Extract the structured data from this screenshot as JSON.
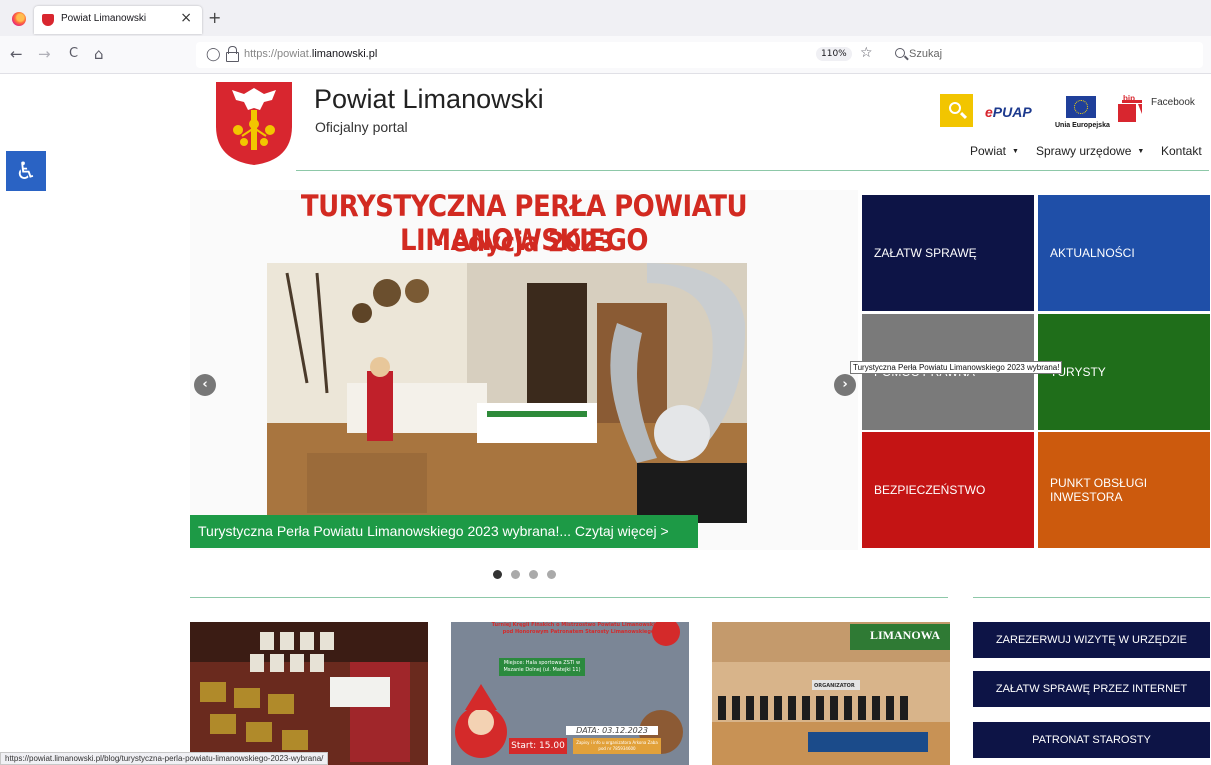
{
  "browser": {
    "tab_title": "Powiat Limanowski",
    "tab_close": "×",
    "new_tab": "+",
    "back": "←",
    "forward": "→",
    "reload": "C",
    "home": "⌂",
    "url_prefix": "https://powiat.",
    "url_domain": "limanowski.pl",
    "zoom": "110%",
    "search_placeholder": "Szukaj"
  },
  "header": {
    "title": "Powiat Limanowski",
    "subtitle": "Oficjalny portal",
    "epuap_prefix": "e",
    "epuap_rest": "PUAP",
    "eu_label": "Unia Europejska",
    "bip_label": "bip",
    "facebook": "Facebook"
  },
  "menu": {
    "items": [
      {
        "label": "Powiat",
        "caret": "▼"
      },
      {
        "label": "Sprawy urzędowe",
        "caret": "▼"
      },
      {
        "label": "Kontakt"
      }
    ]
  },
  "slider": {
    "headline_line1": "TURYSTYCZNA PERŁA POWIATU LIMANOWSKIEGO",
    "headline_line2": "- edycja 2023",
    "caption": "Turystyczna Perła Powiatu Limanowskiego 2023 wybrana!... Czytaj więcej >",
    "prev": "‹",
    "next": "›",
    "slide_count": 4,
    "active_slide": 1
  },
  "tooltip": "Turystyczna Perła Powiatu Limanowskiego 2023 wybrana!",
  "tiles": [
    {
      "label": "ZAŁATW SPRAWĘ",
      "color": "#0d1446"
    },
    {
      "label": "AKTUALNOŚCI",
      "color": "#1f4fa8"
    },
    {
      "label": "POMOC PRAWNA",
      "color": "#7a7a7a"
    },
    {
      "label": "TURYSTY",
      "color": "#1f6e1a"
    },
    {
      "label": "BEZPIECZEŃSTWO",
      "color": "#c41414"
    },
    {
      "label": "PUNKT OBSŁUGI INWESTORA",
      "color": "#cc5a0d"
    }
  ],
  "news": {
    "thumb2": {
      "title": "Turniej Kręgli Fińskich o Mistrzostwo Powiatu Limanowskiego pod Honorowym Patronatem Starosty Limanowskiego",
      "place": "Miejsce: Hala sportowa ZSTI w Mszanie Dolnej (ul. Matejki 11)",
      "date": "DATA: 03.12.2023",
      "start": "Start: 15.00",
      "contact": "Zapisy i info u organizatora Arkona Zaba pod nr 785934600"
    },
    "thumb3": {
      "banner": "LIMANOWA",
      "organizer": "ORGANIZATOR"
    }
  },
  "sidebar_buttons": [
    {
      "label": "ZAREZERWUJ WIZYTĘ W URZĘDZIE"
    },
    {
      "label": "ZAŁATW SPRAWĘ PRZEZ INTERNET"
    },
    {
      "label": "PATRONAT STAROSTY"
    }
  ],
  "status_url": "https://powiat.limanowski.pl/blog/turystyczna-perla-powiatu-limanowskiego-2023-wybrana/",
  "colors": {
    "accent_green": "#1d9a46",
    "headline_red": "#d22a21",
    "navy": "#0d1446",
    "search_yellow": "#f2c500",
    "a11y_blue": "#2a63c4"
  }
}
